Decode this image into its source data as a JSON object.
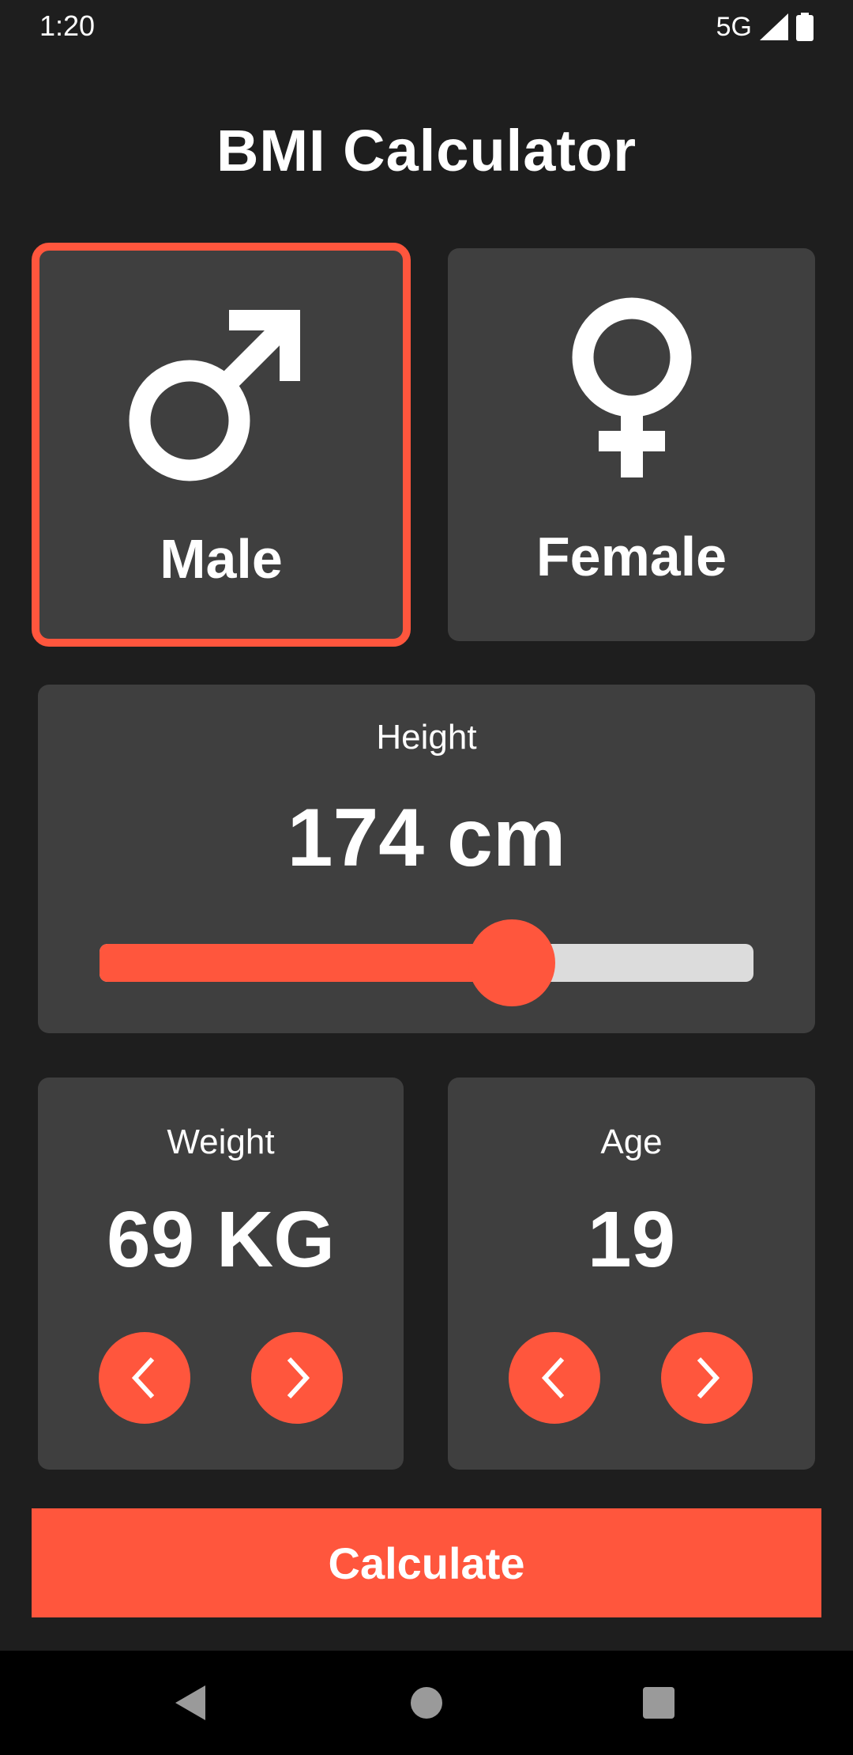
{
  "status_bar": {
    "time": "1:20",
    "network": "5G",
    "icons": [
      "signal-icon",
      "battery-icon"
    ]
  },
  "app": {
    "title": "BMI Calculator"
  },
  "gender": {
    "selected": "male",
    "male_label": "Male",
    "female_label": "Female"
  },
  "height": {
    "label": "Height",
    "value_text": "174 cm",
    "slider_fraction": 0.63
  },
  "weight": {
    "label": "Weight",
    "value_text": "69 KG"
  },
  "age": {
    "label": "Age",
    "value_text": "19"
  },
  "actions": {
    "calculate_label": "Calculate"
  },
  "colors": {
    "accent": "#ff563d",
    "background": "#1e1e1e",
    "card": "#3f3f3f",
    "slider_track": "#dcdcdc"
  },
  "nav_bar": {
    "buttons": [
      "back-icon",
      "home-icon",
      "recents-icon"
    ]
  }
}
